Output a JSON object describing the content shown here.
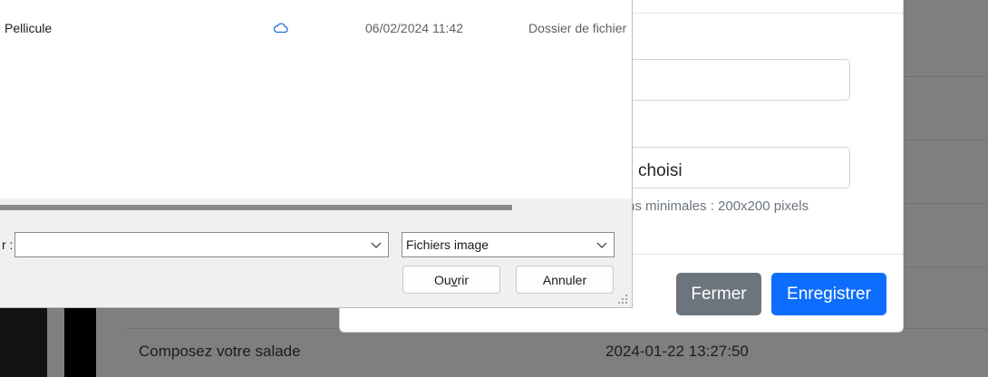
{
  "background": {
    "row_title": "Composez votre salade",
    "row_date": "2024-01-22 13:27:50"
  },
  "modal": {
    "file_input_text": "choisi",
    "help_text": "ns minimales : 200x200 pixels",
    "close_label": "Fermer",
    "save_label": "Enregistrer",
    "colors": {
      "primary": "#0d6efd",
      "secondary": "#6c757d"
    }
  },
  "file_dialog": {
    "rows": [
      {
        "name": "Pellicule",
        "status_icon": "cloud-icon",
        "date": "06/02/2024 11:42",
        "type": "Dossier de fichier"
      }
    ],
    "filename_label": "r :",
    "filename_value": "",
    "filter_value": "Fichiers image",
    "open_label_pre": "Ou",
    "open_label_mnemonic": "v",
    "open_label_post": "rir",
    "cancel_label": "Annuler"
  }
}
